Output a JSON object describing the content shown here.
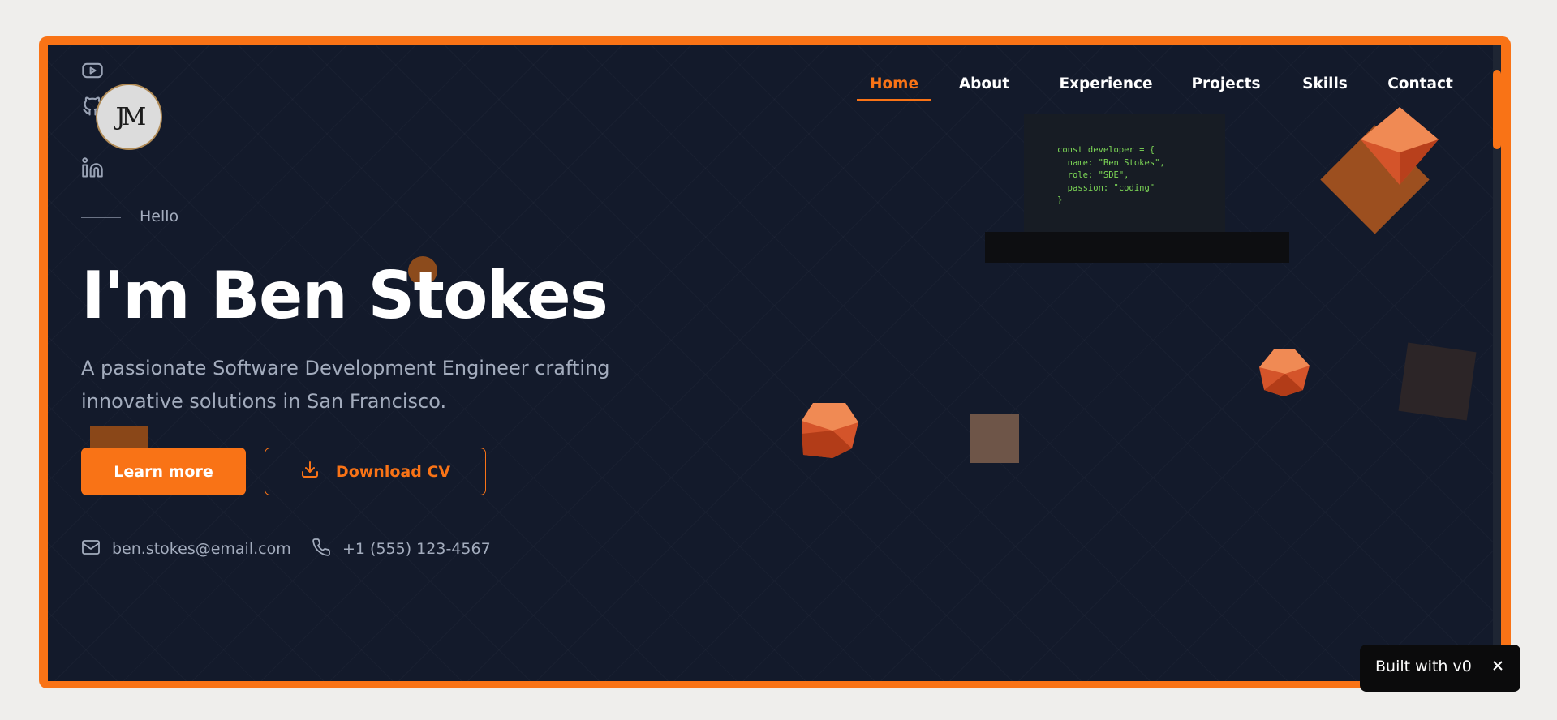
{
  "nav": {
    "items": [
      {
        "label": "Home",
        "active": true
      },
      {
        "label": "About",
        "active": false
      },
      {
        "label": "Experience",
        "active": false
      },
      {
        "label": "Projects",
        "active": false
      },
      {
        "label": "Skills",
        "active": false
      },
      {
        "label": "Contact",
        "active": false
      }
    ]
  },
  "social": {
    "icons": [
      "youtube-icon",
      "github-icon",
      "linkedin-icon"
    ]
  },
  "logo": {
    "monogram": "JM"
  },
  "hero": {
    "greeting": "Hello",
    "title": "I'm Ben Stokes",
    "subtitle": "A passionate Software Development Engineer crafting innovative solutions in San Francisco.",
    "primary_button": "Learn more",
    "secondary_button": "Download CV"
  },
  "contact": {
    "email": "ben.stokes@email.com",
    "phone": "+1 (555) 123-4567"
  },
  "code_snippet": "const developer = {\n  name: \"Ben Stokes\",\n  role: \"SDE\",\n  passion: \"coding\"\n}",
  "badge": {
    "label": "Built with v0"
  },
  "colors": {
    "accent": "#f97316",
    "background": "#131a2b",
    "text_muted": "#a3acbd",
    "code_text": "#7ed957"
  }
}
